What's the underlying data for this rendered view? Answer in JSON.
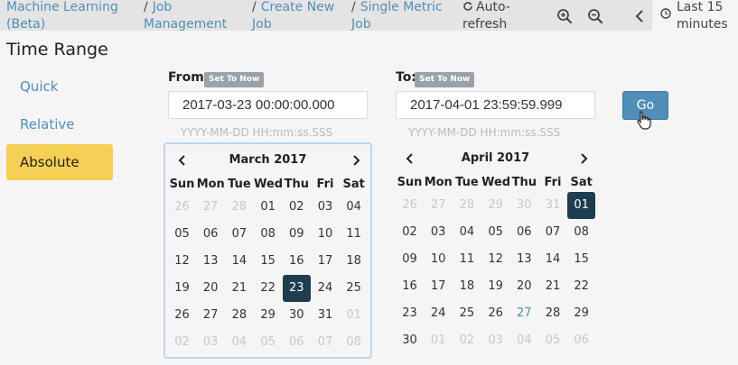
{
  "breadcrumbs": [
    {
      "sep": "",
      "lines": [
        "Machine Learning",
        "(Beta)"
      ]
    },
    {
      "sep": "/",
      "lines": [
        "Job",
        "Management"
      ]
    },
    {
      "sep": "/",
      "lines": [
        "Create New",
        "Job"
      ]
    },
    {
      "sep": "/",
      "lines": [
        "Single Metric",
        "Job"
      ]
    }
  ],
  "toolbar": {
    "auto_refresh": [
      "Auto-",
      "refresh"
    ],
    "last_range": [
      "Last 15",
      "minutes"
    ]
  },
  "time_range": {
    "title": "Time Range",
    "modes": [
      {
        "label": "Quick",
        "active": false
      },
      {
        "label": "Relative",
        "active": false
      },
      {
        "label": "Absolute",
        "active": true
      }
    ]
  },
  "from": {
    "label": "From:",
    "set_to_now": "Set To Now",
    "value": "2017-03-23 00:00:00.000",
    "format_hint": "YYYY-MM-DD HH:mm:ss.SSS"
  },
  "to": {
    "label": "To:",
    "set_to_now": "Set To Now",
    "value": "2017-04-01 23:59:59.999",
    "format_hint": "YYYY-MM-DD HH:mm:ss.SSS"
  },
  "go_label": "Go",
  "weekdays": [
    "Sun",
    "Mon",
    "Tue",
    "Wed",
    "Thu",
    "Fri",
    "Sat"
  ],
  "calendars": [
    {
      "month_label": "March 2017",
      "selected": "23",
      "today": "",
      "weeks": [
        [
          "26",
          "27",
          "28",
          "01",
          "02",
          "03",
          "04"
        ],
        [
          "05",
          "06",
          "07",
          "08",
          "09",
          "10",
          "11"
        ],
        [
          "12",
          "13",
          "14",
          "15",
          "16",
          "17",
          "18"
        ],
        [
          "19",
          "20",
          "21",
          "22",
          "23",
          "24",
          "25"
        ],
        [
          "26",
          "27",
          "28",
          "29",
          "30",
          "31",
          "01"
        ],
        [
          "02",
          "03",
          "04",
          "05",
          "06",
          "07",
          "08"
        ]
      ],
      "first_in_month": [
        0,
        3
      ],
      "last_in_month": [
        4,
        5
      ]
    },
    {
      "month_label": "April 2017",
      "selected": "01",
      "today": "27",
      "weeks": [
        [
          "26",
          "27",
          "28",
          "29",
          "30",
          "31",
          "01"
        ],
        [
          "02",
          "03",
          "04",
          "05",
          "06",
          "07",
          "08"
        ],
        [
          "09",
          "10",
          "11",
          "12",
          "13",
          "14",
          "15"
        ],
        [
          "16",
          "17",
          "18",
          "19",
          "20",
          "21",
          "22"
        ],
        [
          "23",
          "24",
          "25",
          "26",
          "27",
          "28",
          "29"
        ],
        [
          "30",
          "01",
          "02",
          "03",
          "04",
          "05",
          "06"
        ]
      ],
      "first_in_month": [
        0,
        6
      ],
      "last_in_month": [
        5,
        0
      ]
    }
  ]
}
